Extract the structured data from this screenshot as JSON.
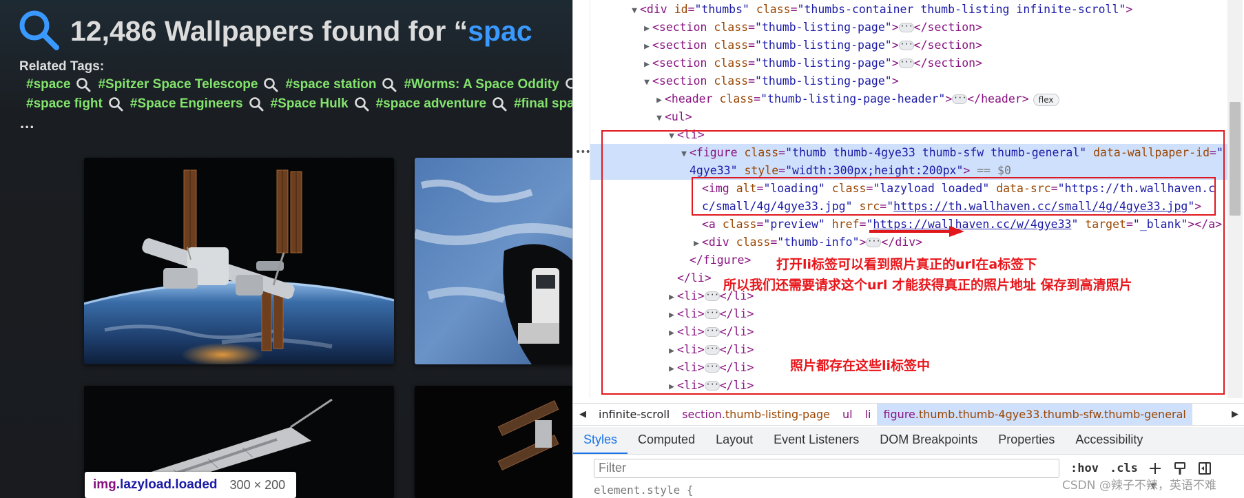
{
  "results": {
    "count": "12,486",
    "prefix": "Wallpapers found for “",
    "query": "spac"
  },
  "related": {
    "title": "Related Tags:",
    "row1": [
      "#space",
      "#Spitzer Space Telescope",
      "#space station",
      "#Worms: A Space Oddity"
    ],
    "row2": [
      "#space fight",
      "#Space Engineers",
      "#Space Hulk",
      "#space adventure",
      "#final spa"
    ],
    "more": "..."
  },
  "tooltip": {
    "element": "img",
    "classes": ".lazyload.loaded",
    "size": "300 × 200"
  },
  "dom": {
    "l0": {
      "open": "<div",
      "attr1": "id",
      "val1": "\"thumbs\"",
      "attr2": "class",
      "val2": "\"thumbs-container thumb-listing infinite-scroll\"",
      "close": ">"
    },
    "section_open": "<section",
    "section_attr": "class",
    "section_val": "\"thumb-listing-page\"",
    "section_close": "</section>",
    "section_gt": ">",
    "header_open": "<header",
    "header_attr": "class",
    "header_val": "\"thumb-listing-page-header\"",
    "header_close": "</header>",
    "flex_badge": "flex",
    "ul_open": "<ul>",
    "li_open": "<li>",
    "li_close": "</li>",
    "figure_open": "<figure",
    "figure_attr1": "class",
    "figure_val1": "\"thumb thumb-4gye33 thumb-sfw thumb-general\"",
    "figure_attr2": "data-wallpaper-id",
    "figure_val2a": "\"",
    "figure_val2b": "4gye33\"",
    "figure_attr3": "style",
    "figure_val3": "\"width:300px;height:200px\"",
    "figure_eq": "== $0",
    "img_open": "<img",
    "img_attr1": "alt",
    "img_val1": "\"loading\"",
    "img_attr2": "class",
    "img_val2": "\"lazyload loaded\"",
    "img_attr3": "data-src",
    "img_val3a": "\"https://th.wallhaven.c",
    "img_val3b": "c/small/4g/4gye33.jpg\"",
    "img_attr4": "src",
    "img_val4_q": "\"",
    "img_val4": "https://th.wallhaven.cc/small/4g/4gye33.jpg",
    "a_open": "<a",
    "a_attr1": "class",
    "a_val1": "\"preview\"",
    "a_attr2": "href",
    "a_val2": "https://wallhaven.cc/w/4gye33",
    "a_attr3": "target",
    "a_val3": "\"_blank\"",
    "a_close": "></a>",
    "div_open": "<div",
    "div_attr": "class",
    "div_val": "\"thumb-info\"",
    "div_close": "</div>",
    "figure_close": "</figure>"
  },
  "annotations": {
    "a_tag_note": "打开li标签可以看到照片真正的url在a标签下",
    "request_note": "所以我们还需要请求这个url 才能获得真正的照片地址 保存到高清照片",
    "li_note": "照片都存在这些li标签中"
  },
  "breadcrumb": [
    {
      "text": "infinite-scroll",
      "type": "plain"
    },
    {
      "tag": "section",
      "cls": ".thumb-listing-page",
      "type": "tagcls"
    },
    {
      "tag": "ul",
      "type": "tag"
    },
    {
      "tag": "li",
      "type": "tag"
    },
    {
      "tag": "figure",
      "cls": ".thumb.thumb-4gye33.thumb-sfw.thumb-general",
      "type": "tagcls",
      "active": true
    }
  ],
  "tabs": [
    "Styles",
    "Computed",
    "Layout",
    "Event Listeners",
    "DOM Breakpoints",
    "Properties",
    "Accessibility"
  ],
  "filter": {
    "placeholder": "Filter",
    "hov": ":hov",
    "cls": ".cls"
  },
  "styles": {
    "selector": "element.style {"
  },
  "watermark": "CSDN @辣子不辣，英语不难",
  "colors": {
    "accent": "#1a73e8",
    "annotation_red": "#e0181d",
    "tag_green": "#84e36d",
    "query_blue": "#3a99ff"
  }
}
